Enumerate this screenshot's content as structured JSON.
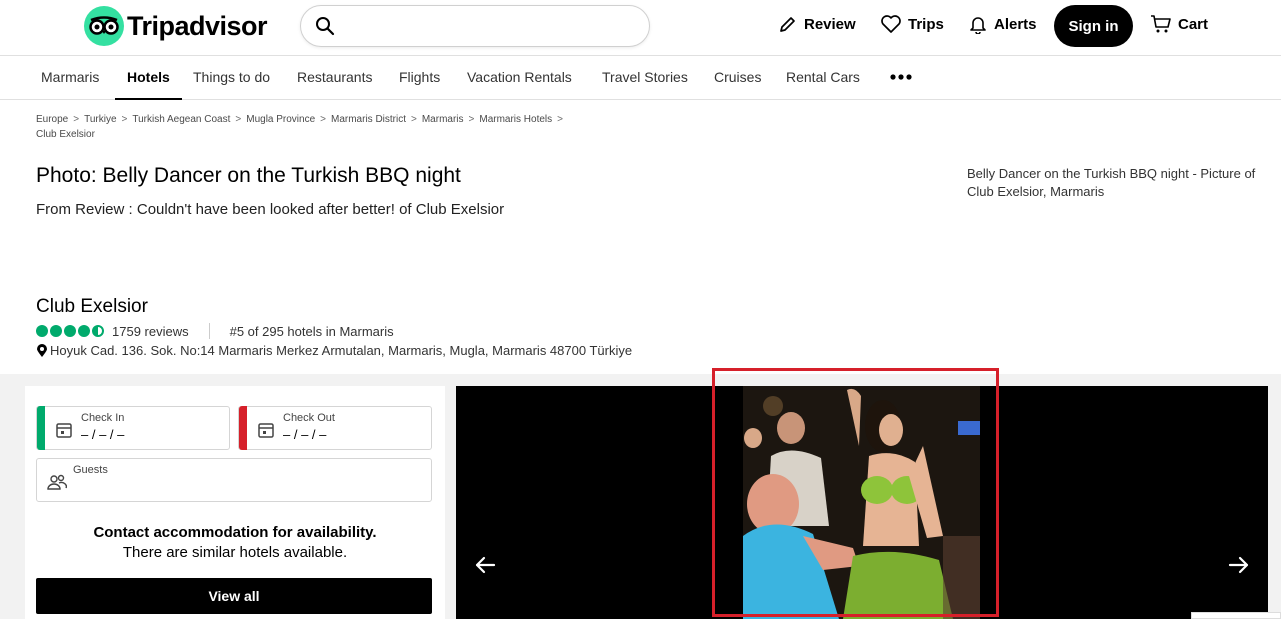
{
  "header": {
    "brand": "Tripadvisor",
    "search_placeholder": "",
    "nav": {
      "review": "Review",
      "trips": "Trips",
      "alerts": "Alerts",
      "signin": "Sign in",
      "cart": "Cart"
    }
  },
  "tabs": [
    {
      "label": "Marmaris"
    },
    {
      "label": "Hotels",
      "active": true
    },
    {
      "label": "Things to do"
    },
    {
      "label": "Restaurants"
    },
    {
      "label": "Flights"
    },
    {
      "label": "Vacation Rentals"
    },
    {
      "label": "Travel Stories"
    },
    {
      "label": "Cruises"
    },
    {
      "label": "Rental Cars"
    }
  ],
  "breadcrumbs": [
    "Europe",
    "Turkiye",
    "Turkish Aegean Coast",
    "Mugla Province",
    "Marmaris District",
    "Marmaris",
    "Marmaris Hotels",
    "Club Exelsior"
  ],
  "photo": {
    "title": "Photo: Belly Dancer on the Turkish BBQ night",
    "from_review_prefix": "From Review : ",
    "review_title": "Couldn't have been looked after better!",
    "of_text": " of ",
    "hotel_link": "Club Exelsior",
    "side_caption": "Belly Dancer on the Turkish BBQ night - Picture of Club Exelsior, Marmaris"
  },
  "hotel": {
    "name": "Club Exelsior",
    "rating_bubbles": 4.5,
    "reviews": "1759 reviews",
    "rank": "#5 of 295 hotels in Marmaris",
    "address": "Hoyuk Cad. 136. Sok. No:14 Marmaris Merkez Armutalan, Marmaris, Mugla, Marmaris 48700 Türkiye"
  },
  "booking": {
    "check_in_label": "Check In",
    "check_in_value": "– / – / –",
    "check_out_label": "Check Out",
    "check_out_value": "– / – / –",
    "guests_label": "Guests",
    "availability_title": "Contact accommodation for availability.",
    "availability_sub": "There are similar hotels available.",
    "view_all": "View all"
  },
  "colors": {
    "brand_green": "#34e0a1",
    "bubble_green": "#00aa6c",
    "check_in_bar": "#00aa6c",
    "check_out_bar": "#d6202a",
    "highlight": "#d6202a"
  }
}
